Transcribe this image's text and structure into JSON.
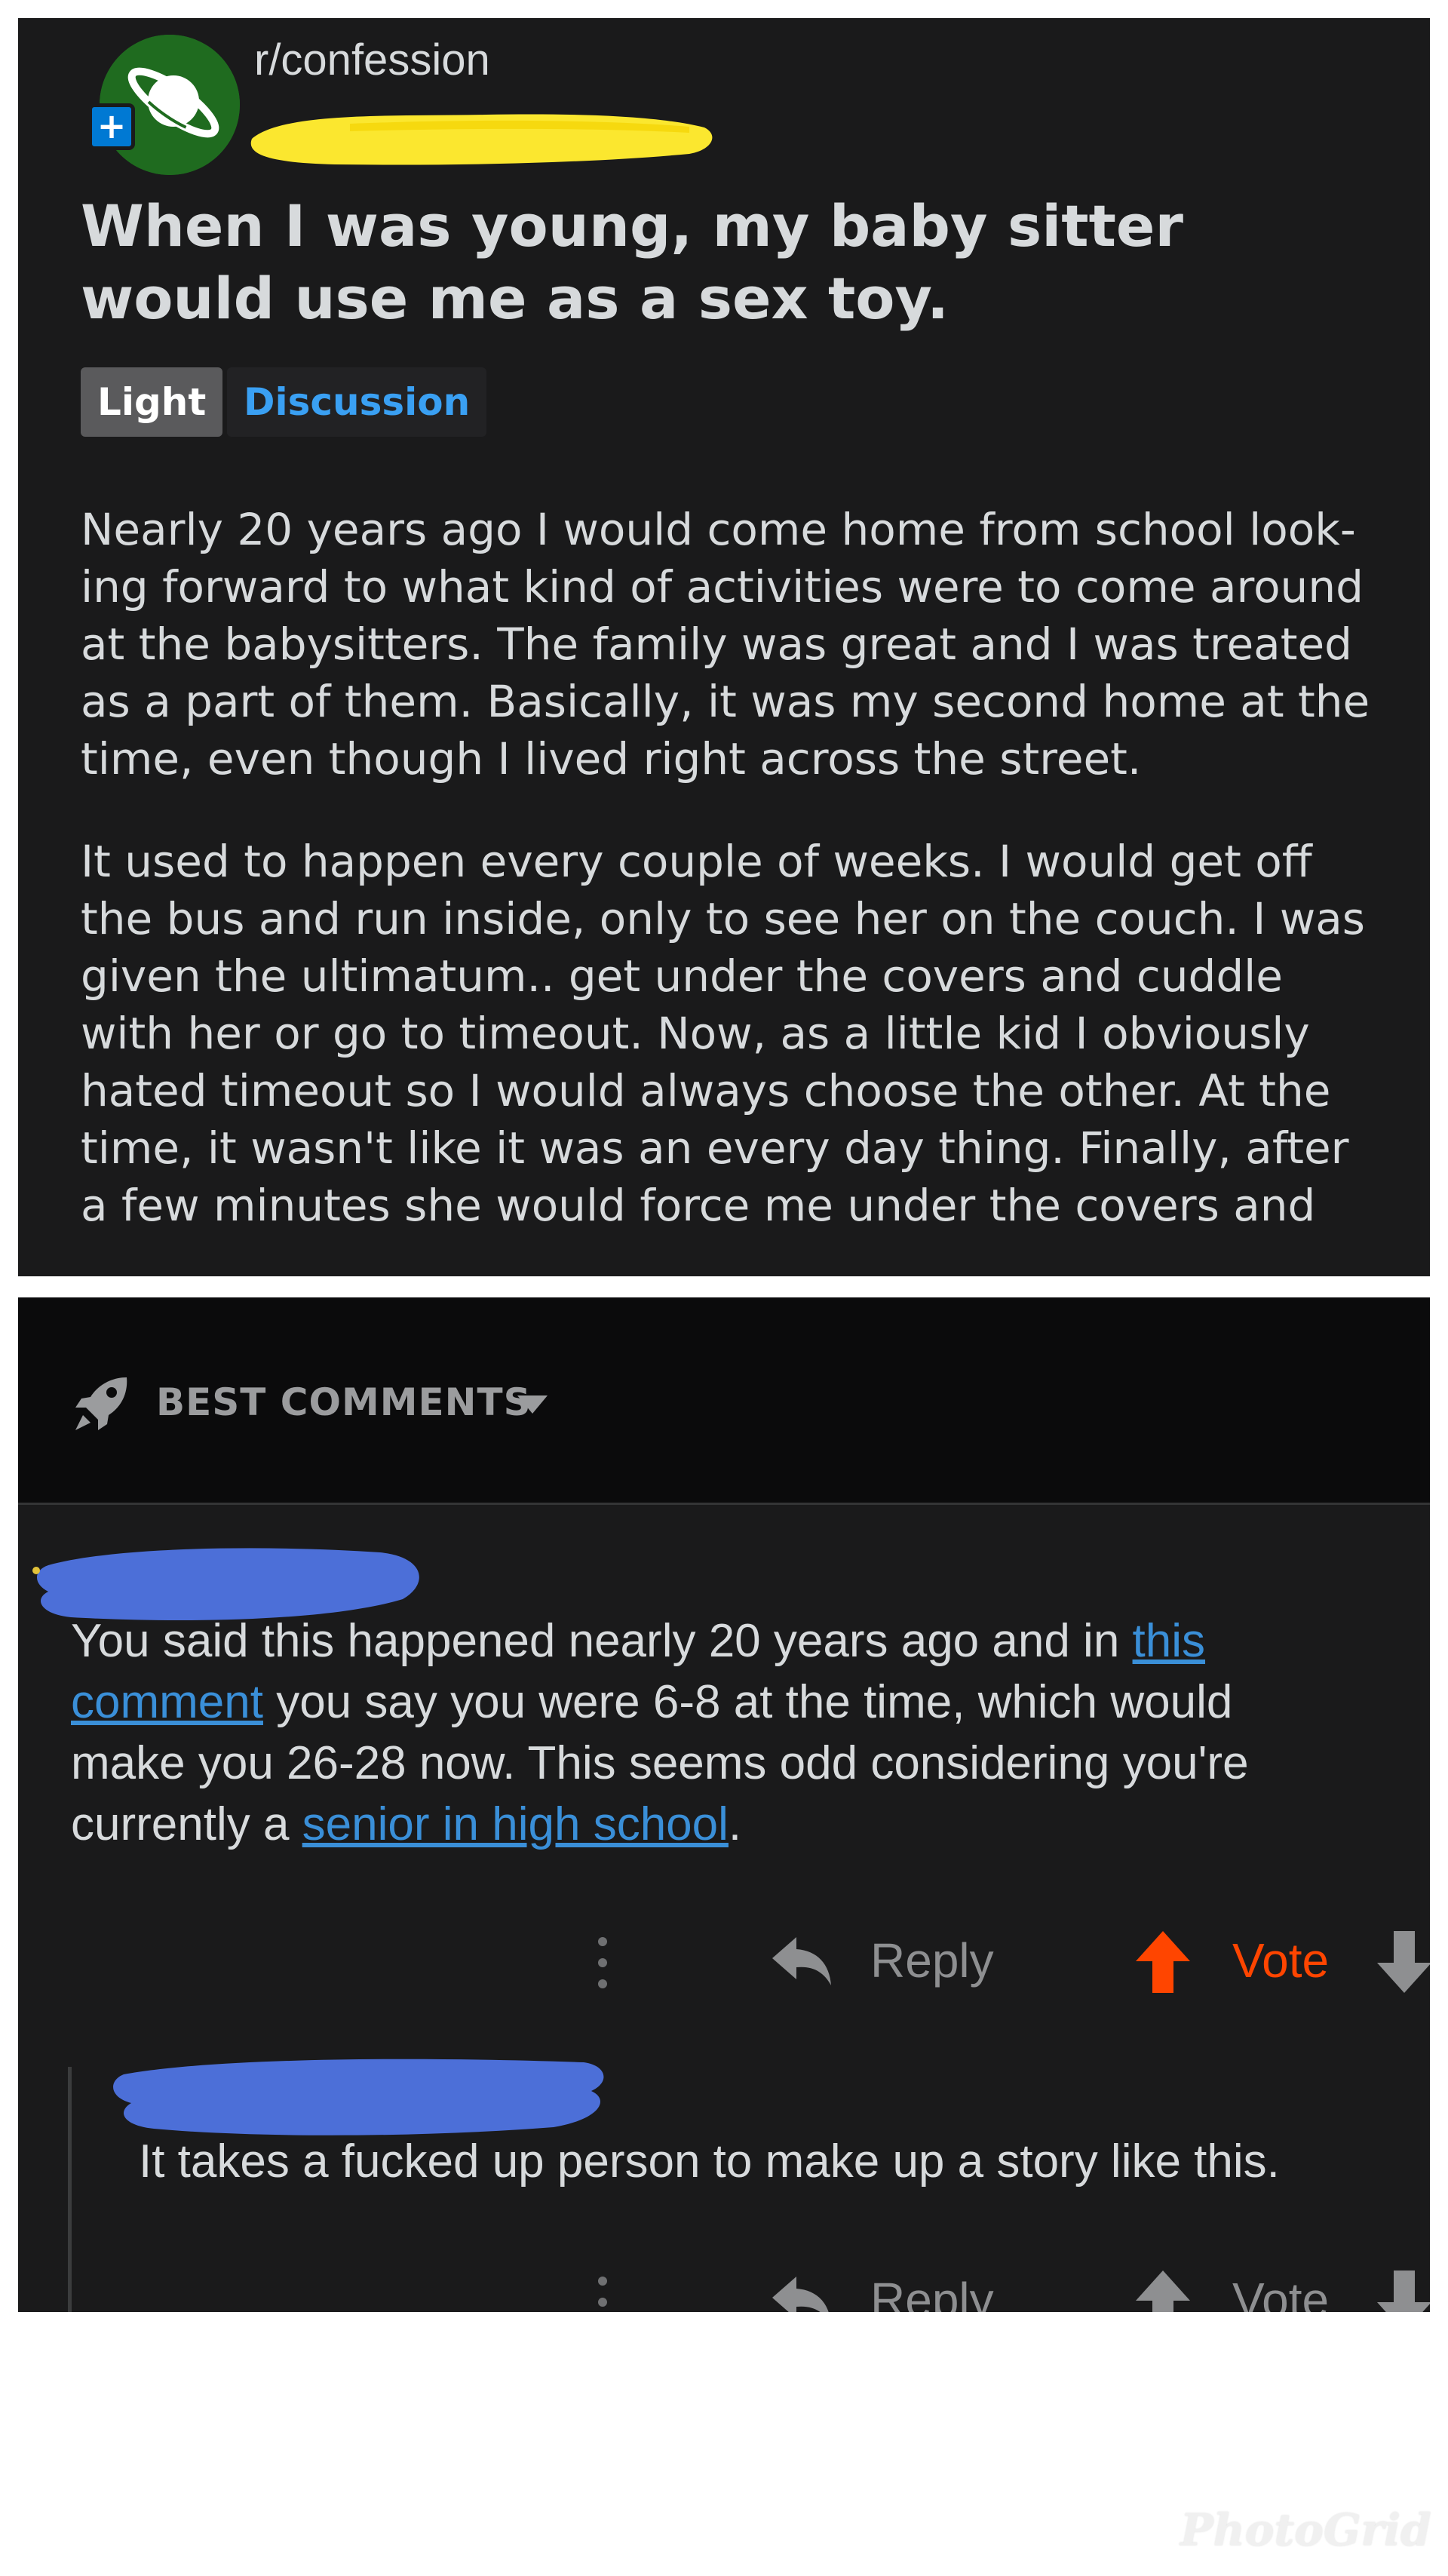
{
  "post": {
    "subreddit": "r/confession",
    "join_symbol": "+",
    "title": "When I was young, my baby sitter would use me as a sex toy.",
    "flairs": [
      "Light",
      "Discussion"
    ],
    "body_paragraphs": [
      [
        "Nearly 20 years ago I would come home from school look-",
        "ing forward to what kind of activities were to come around",
        "at the babysitters. The family was great and I was treated",
        "as a part of them. Basically, it was my second home at the",
        "time, even though I lived right across the street."
      ],
      [
        "It used to happen every couple of weeks. I would get off",
        "the bus and run inside, only to see her on the couch. I was",
        "given the ultimatum.. get under the covers and cuddle",
        "with her or go to timeout. Now, as a little kid I obviously",
        "hated timeout so I would always choose the other. At the",
        "time, it wasn't like it was an every day thing. Finally, after",
        "a few minutes she would force me under the covers and"
      ]
    ]
  },
  "comments_header": {
    "sort_label": "BEST COMMENTS"
  },
  "comment": {
    "line1_pre": "You said this happened nearly 20 years ago and in ",
    "link1_part1": "this",
    "link1_part2": "comment",
    "line2_post": " you say you were 6-8 at the time, which would",
    "line3": "make you 26-28 now. This seems odd considering you're",
    "line4_pre": "currently a ",
    "link2": "senior in high school",
    "line4_post": "."
  },
  "reply": {
    "text": "It takes a fucked up person to make up a story like this."
  },
  "actions": {
    "reply_label": "Reply",
    "vote_label": "Vote"
  },
  "colors": {
    "panel_bg": "#1a1a1b",
    "header_bg": "#0b0b0c",
    "text": "#d7dadc",
    "link": "#3a8fd8",
    "upvote": "#ff4500",
    "redaction_yellow": "#fbe72f",
    "redaction_blue": "#4c6fd8"
  },
  "icons": [
    "planet-icon",
    "plus-icon",
    "rocket-icon",
    "caret-down-icon",
    "more-vertical-icon",
    "reply-arrow-icon",
    "upvote-arrow-icon",
    "downvote-arrow-icon"
  ],
  "watermark": "PhotoGrid"
}
